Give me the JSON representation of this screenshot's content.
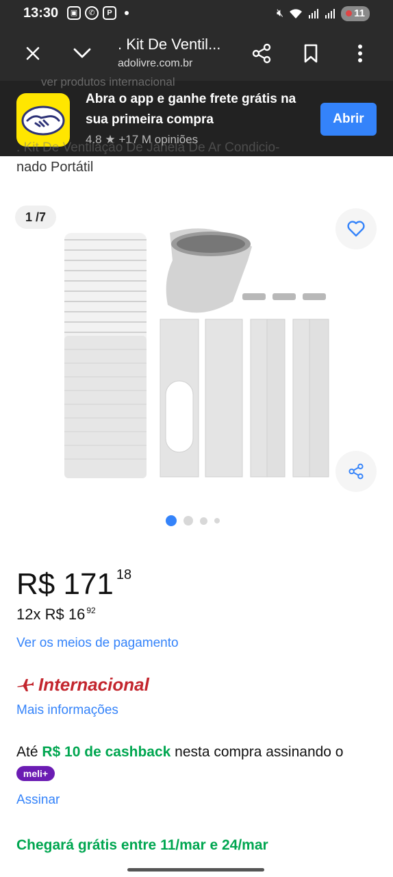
{
  "status_bar": {
    "time": "13:30",
    "battery": "11"
  },
  "browser": {
    "page_title": ". Kit De Ventil...",
    "url": "adolivre.com.br"
  },
  "app_banner": {
    "message": "Abra o app e ganhe frete grátis na sua primeira compra",
    "open_label": "Abrir",
    "ghost_text": "ver produtos internacional",
    "rating": "4.8",
    "opinions": "+17 M opiniões"
  },
  "product": {
    "title_partial": ". Kit De Ventilação De Janela De Ar Condicio-",
    "title_line2": "nado Portátil",
    "image_counter": "1 /7",
    "carousel_total": 4,
    "carousel_active": 1
  },
  "pricing": {
    "currency": "R$",
    "price_int": "171",
    "price_cents": "18",
    "installments_prefix": "12x R$",
    "installment_int": "16",
    "installment_cents": "92",
    "payment_link": "Ver os meios de pagamento"
  },
  "international": {
    "label": "Internacional",
    "more_info": "Mais informações"
  },
  "cashback": {
    "prefix": "Até",
    "highlight": "R$ 10 de cashback",
    "suffix": "nesta compra assinando o",
    "badge": "meli+",
    "subscribe": "Assinar"
  },
  "delivery": {
    "text": "Chegará grátis entre 11/mar e 24/mar"
  },
  "colors": {
    "accent_blue": "#3483fa",
    "brand_yellow": "#ffe600",
    "success_green": "#00a650",
    "international_red": "#c3262e",
    "meli_purple": "#6b1cb3"
  }
}
